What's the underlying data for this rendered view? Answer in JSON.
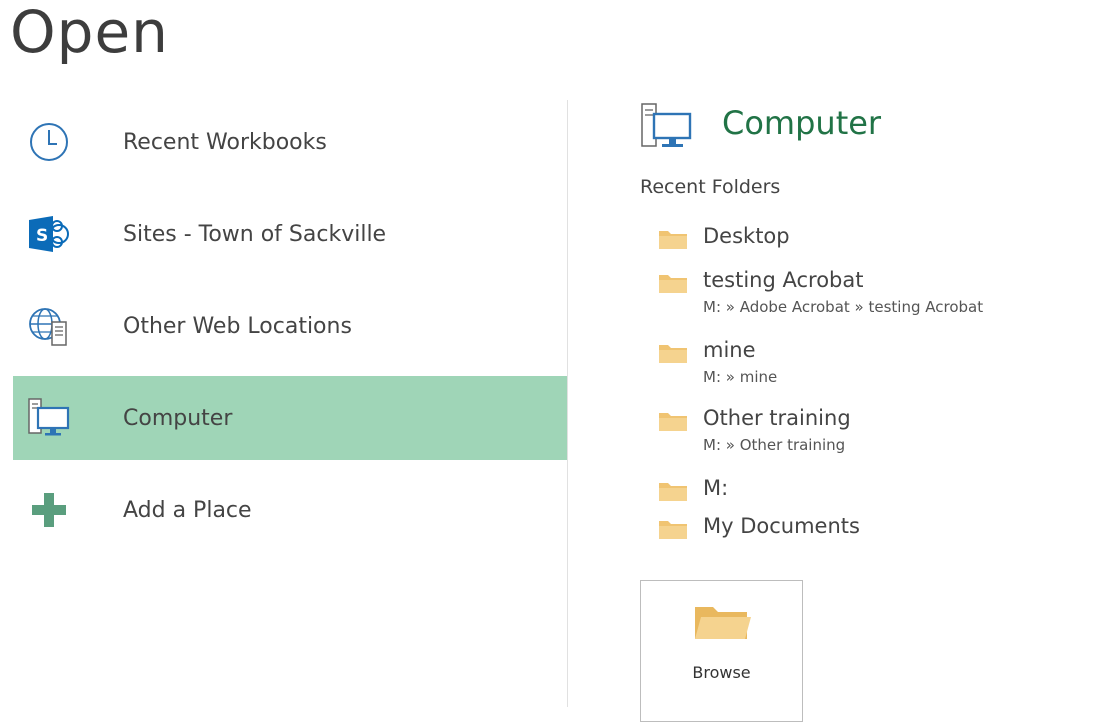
{
  "page": {
    "title": "Open"
  },
  "places": [
    {
      "label": "Recent Workbooks",
      "icon": "clock-icon",
      "selected": false
    },
    {
      "label": "Sites - Town of Sackville",
      "icon": "sharepoint-icon",
      "selected": false
    },
    {
      "label": "Other Web Locations",
      "icon": "globe-server-icon",
      "selected": false
    },
    {
      "label": "Computer",
      "icon": "computer-icon",
      "selected": true
    },
    {
      "label": "Add a Place",
      "icon": "plus-icon",
      "selected": false
    }
  ],
  "panel": {
    "heading": "Computer",
    "recent_label": "Recent Folders",
    "folders": [
      {
        "name": "Desktop",
        "path": ""
      },
      {
        "name": "testing Acrobat",
        "path": "M: » Adobe Acrobat » testing Acrobat"
      },
      {
        "name": "mine",
        "path": "M: » mine"
      },
      {
        "name": "Other training",
        "path": "M: » Other training"
      },
      {
        "name": "M:",
        "path": ""
      },
      {
        "name": "My Documents",
        "path": ""
      }
    ],
    "browse_label": "Browse"
  },
  "colors": {
    "accent": "#217346",
    "selected_bg": "#9fd5b7",
    "folder": "#f0c472",
    "icon_blue": "#2e74b5",
    "plus": "#5a9e7e"
  }
}
